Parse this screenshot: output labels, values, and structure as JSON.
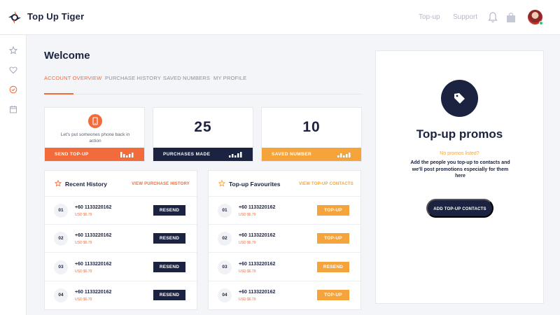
{
  "brand": {
    "name": "Top Up Tiger",
    "accent": "#f26b3a",
    "navy": "#1c2340",
    "amber": "#f5a33b"
  },
  "header": {
    "nav": [
      "Top-up",
      "Support"
    ],
    "icons": [
      "bell-icon",
      "bag-icon",
      "avatar"
    ]
  },
  "sidebar": {
    "items": [
      "star-icon",
      "heart-icon",
      "check-circle-icon",
      "calendar-icon"
    ]
  },
  "main": {
    "title": "Welcome",
    "tabs": [
      {
        "label": "ACCOUNT OVERVIEW",
        "active": true
      },
      {
        "label": "PURCHASE HISTORY",
        "active": false
      },
      {
        "label": "SAVED NUMBERS",
        "active": false
      },
      {
        "label": "MY PROFILE",
        "active": false
      }
    ]
  },
  "stats": {
    "send": {
      "message": "Let's put someones phone back in action",
      "footer": "SEND TOP-UP",
      "color": "#f26b3a"
    },
    "purchases": {
      "value": "25",
      "footer": "PURCHASES MADE",
      "color": "#1c2340"
    },
    "saved": {
      "value": "10",
      "footer": "SAVED NUMBER",
      "color": "#f5a33b"
    }
  },
  "recent_history": {
    "title": "Recent History",
    "link": "VIEW PURCHASE HISTORY",
    "rows": [
      {
        "index": "01",
        "phone": "+60 1133220162",
        "price": "USD $6.79",
        "action": "RESEND"
      },
      {
        "index": "02",
        "phone": "+60 1133220162",
        "price": "USD $6.79",
        "action": "RESEND"
      },
      {
        "index": "03",
        "phone": "+60 1133220162",
        "price": "USD $6.79",
        "action": "RESEND"
      },
      {
        "index": "04",
        "phone": "+60 1133220162",
        "price": "USD $6.79",
        "action": "RESEND"
      }
    ]
  },
  "favourites": {
    "title": "Top-up Favourites",
    "link": "VIEW TOP-UP CONTACTS",
    "rows": [
      {
        "index": "01",
        "phone": "+60 1133220162",
        "price": "USD $6.79",
        "action": "TOP-UP"
      },
      {
        "index": "02",
        "phone": "+60 1133220162",
        "price": "USD $6.79",
        "action": "TOP-UP"
      },
      {
        "index": "03",
        "phone": "+60 1133220162",
        "price": "USD $6.79",
        "action": "RESEND"
      },
      {
        "index": "04",
        "phone": "+60 1133220162",
        "price": "USD $6.79",
        "action": "TOP-UP"
      }
    ]
  },
  "promo": {
    "title": "Top-up promos",
    "empty": "No promos listed?",
    "description": "Add the people you top-up to contacts and we'll post promotions especially for them here",
    "button": "ADD TOP-UP CONTACTS"
  }
}
